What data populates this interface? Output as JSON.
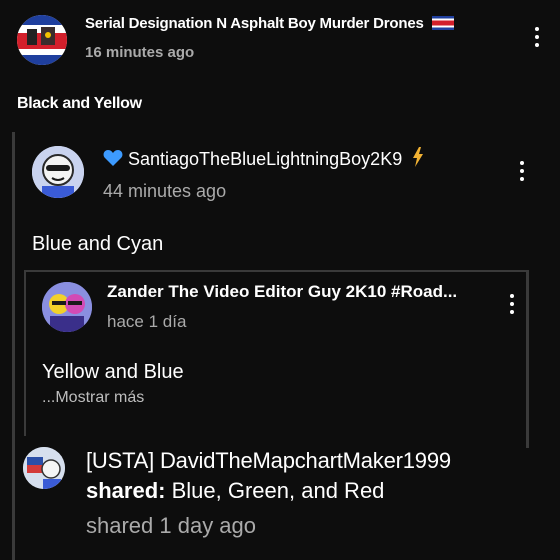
{
  "post": {
    "author": "Serial Designation N Asphalt Boy Murder Drones",
    "author_flag": "costa-rica-flag",
    "time": "16 minutes ago",
    "body": "Black and Yellow"
  },
  "reply1": {
    "author": "SantiagoTheBlueLightningBoy2K9",
    "prefix_icon": "blue-heart-icon",
    "suffix_icon": "lightning-icon",
    "time": "44 minutes ago",
    "body": "Blue and Cyan"
  },
  "reply2": {
    "author": "Zander The Video Editor Guy 2K10 #Road...",
    "time": "hace 1 día",
    "body": "Yellow and Blue",
    "more": "...Mostrar más"
  },
  "reply3": {
    "author": "[USTA] DavidTheMapchartMaker1999",
    "shared_label": "shared:",
    "shared_text": "Blue, Green, and Red",
    "time": "shared 1 day ago"
  },
  "colors": {
    "background": "#0d0d0d",
    "secondary_text": "#aaaaaa",
    "thread_line": "#3a3a3a",
    "heart": "#3d9bff",
    "lightning": "#f2b233"
  }
}
